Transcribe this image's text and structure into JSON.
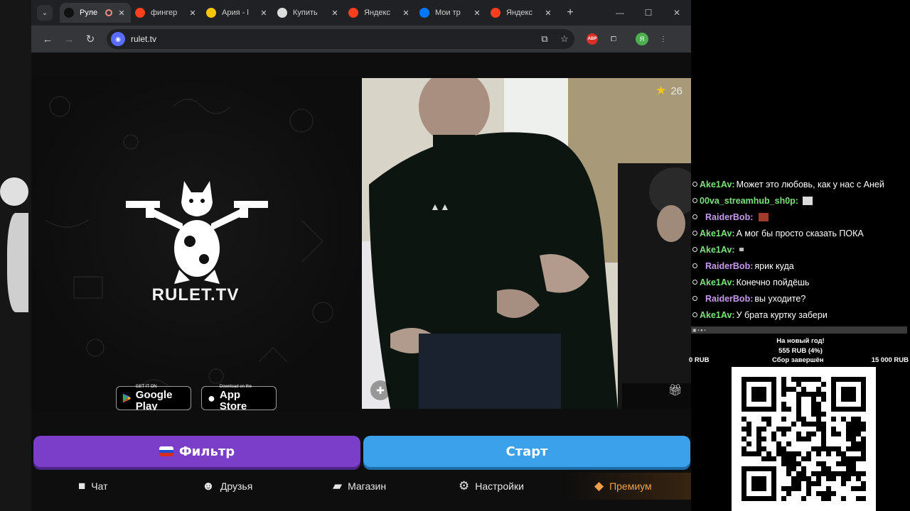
{
  "browser": {
    "tabs": [
      {
        "title": "Руле",
        "favicon": "rulet",
        "color": "#111111",
        "active": true,
        "recording": true
      },
      {
        "title": "фингер",
        "favicon": "yandex",
        "color": "#fc3f1d"
      },
      {
        "title": "Ария - l",
        "favicon": "music",
        "color": "#f7c600"
      },
      {
        "title": "Купить",
        "favicon": "shop",
        "color": "#dcdcdc"
      },
      {
        "title": "Яндекс",
        "favicon": "yandex",
        "color": "#fc3f1d"
      },
      {
        "title": "Мои тр",
        "favicon": "vk",
        "color": "#0077ff"
      },
      {
        "title": "Яндекс",
        "favicon": "yandex",
        "color": "#fc3f1d"
      }
    ],
    "url": "rulet.tv",
    "abp_label": "ABP",
    "profile_initial": "Я"
  },
  "site": {
    "brand": "RULET.TV",
    "google_play": {
      "small": "GET IT ON",
      "big": "Google Play"
    },
    "app_store": {
      "small": "Download on the",
      "big": "App Store"
    },
    "rating": "26",
    "filter_label": "Фильтр",
    "start_label": "Старт",
    "nav": [
      {
        "label": "Чат",
        "icon": "chat-icon"
      },
      {
        "label": "Друзья",
        "icon": "friends-icon"
      },
      {
        "label": "Магазин",
        "icon": "shop-bag-icon"
      },
      {
        "label": "Настройки",
        "icon": "gear-icon"
      },
      {
        "label": "Премиум",
        "icon": "tag-icon"
      }
    ]
  },
  "chat": {
    "messages": [
      {
        "nick": "Ake1Av:",
        "color": "green",
        "text": "Может это любовь, как у нас с Аней"
      },
      {
        "nick": "00va_streamhub_sh0p:",
        "color": "green",
        "text": "",
        "emote": "hand"
      },
      {
        "nick": "RaiderBob:",
        "color": "purple",
        "text": "",
        "emote": "big"
      },
      {
        "nick": "Ake1Av:",
        "color": "green",
        "text": "А мог бы просто сказать ПОКА"
      },
      {
        "nick": "Ake1Av:",
        "color": "green",
        "text": "",
        "emote": "small"
      },
      {
        "nick": "RaiderBob:",
        "color": "purple",
        "text": "ярик куда"
      },
      {
        "nick": "Ake1Av:",
        "color": "green",
        "text": "Конечно пойдёшь"
      },
      {
        "nick": "RaiderBob:",
        "color": "purple",
        "text": "вы уходите?"
      },
      {
        "nick": "Ake1Av:",
        "color": "green",
        "text": "У брата куртку забери"
      }
    ]
  },
  "donation": {
    "title": "На новый год!",
    "amount": "555 RUB (4%)",
    "min": "0 RUB",
    "status": "Сбор завершён",
    "max": "15 000 RUB"
  }
}
